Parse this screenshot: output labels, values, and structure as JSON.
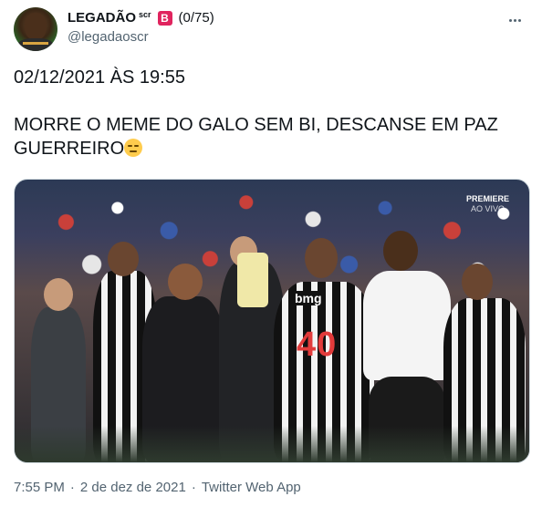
{
  "tweet": {
    "author": {
      "display_name": "LEGADÃO",
      "name_superscript": "scr",
      "badge_letter": "B",
      "counter": "(0/75)",
      "handle": "@legadaoscr"
    },
    "text_line1": "02/12/2021 ÀS 19:55",
    "text_line2": "MORRE O MEME DO GALO SEM BI, DESCANSE EM PAZ GUERREIRO",
    "emoji": "pensive-face",
    "media": {
      "sponsor_text": "bmg",
      "jersey_number": "40",
      "watermark_brand": "PREMIERE",
      "watermark_live": "AO VIVO"
    },
    "footer": {
      "time": "7:55 PM",
      "separator": "·",
      "date": "2 de dez de 2021",
      "source": "Twitter Web App"
    }
  },
  "colors": {
    "text_primary": "#0f1419",
    "text_secondary": "#536471",
    "badge": "#e0245e",
    "border": "#cfd9de"
  }
}
